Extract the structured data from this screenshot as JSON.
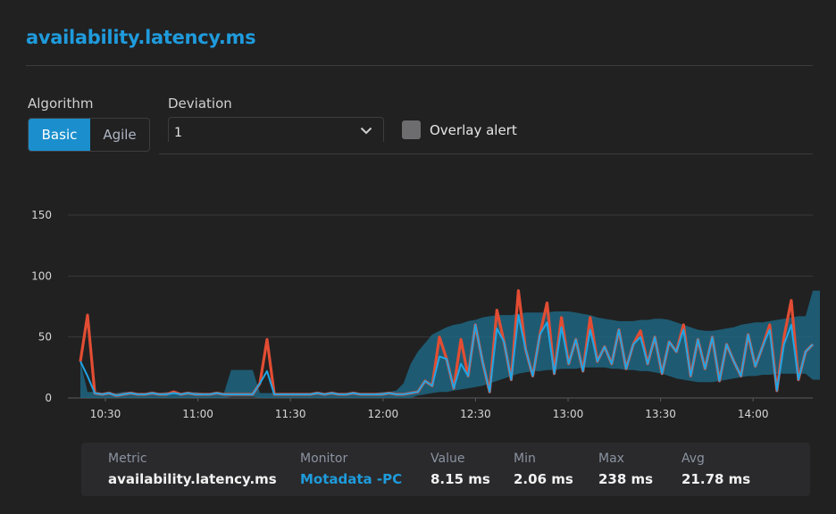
{
  "title": "availability.latency.ms",
  "algorithm": {
    "label": "Algorithm",
    "options": [
      "Basic",
      "Agile"
    ],
    "selected": "Basic"
  },
  "deviation": {
    "label": "Deviation",
    "value": "1"
  },
  "overlay_alert": {
    "label": "Overlay alert",
    "checked": false
  },
  "colors": {
    "accent": "#1f9bdc",
    "band": "#1d6f8e",
    "line": "#1fa6e6",
    "anomaly": "#e24d33",
    "background": "#212122"
  },
  "chart_data": {
    "type": "line",
    "x": [
      "10:30",
      "11:00",
      "11:30",
      "12:00",
      "12:30",
      "13:00",
      "13:30",
      "14:00"
    ],
    "y_ticks": [
      0,
      50,
      100,
      150
    ],
    "ylim": [
      0,
      150
    ],
    "grid": true,
    "series": [
      {
        "role": "baseline band (deviation)",
        "upper": [
          30,
          5,
          5,
          4,
          4,
          4,
          5,
          5,
          4,
          4,
          4,
          4,
          5,
          4,
          4,
          4,
          5,
          4,
          4,
          4,
          4,
          23,
          23,
          23,
          23,
          4,
          4,
          4,
          4,
          4,
          4,
          4,
          4,
          4,
          4,
          4,
          4,
          4,
          4,
          4,
          4,
          4,
          5,
          5,
          6,
          12,
          28,
          38,
          45,
          52,
          55,
          58,
          60,
          61,
          63,
          64,
          66,
          67,
          68,
          68,
          68,
          69,
          70,
          70,
          70,
          70,
          71,
          71,
          71,
          70,
          69,
          68,
          66,
          65,
          64,
          63,
          63,
          63,
          64,
          64,
          65,
          65,
          64,
          62,
          60,
          58,
          56,
          55,
          55,
          56,
          57,
          58,
          60,
          61,
          62,
          62,
          63,
          64,
          65,
          66,
          67,
          67,
          88,
          88
        ],
        "lower": [
          0,
          0,
          0,
          0,
          0,
          0,
          0,
          0,
          0,
          0,
          0,
          0,
          0,
          0,
          0,
          0,
          0,
          0,
          0,
          0,
          0,
          1,
          1,
          1,
          1,
          0,
          0,
          0,
          0,
          0,
          0,
          0,
          0,
          0,
          0,
          0,
          0,
          0,
          0,
          0,
          0,
          0,
          0,
          0,
          0,
          0,
          0,
          2,
          3,
          4,
          5,
          5,
          6,
          7,
          8,
          9,
          10,
          12,
          14,
          16,
          18,
          20,
          21,
          22,
          22,
          23,
          23,
          24,
          24,
          24,
          25,
          25,
          25,
          25,
          24,
          24,
          23,
          23,
          22,
          22,
          21,
          20,
          18,
          16,
          15,
          14,
          13,
          13,
          13,
          14,
          15,
          16,
          17,
          18,
          18,
          19,
          19,
          20,
          20,
          20,
          20,
          20,
          15,
          15
        ]
      },
      {
        "role": "latency (anomaly overlay)",
        "values": [
          30,
          68,
          4,
          3,
          4,
          2,
          3,
          4,
          3,
          3,
          4,
          3,
          3,
          5,
          3,
          4,
          3,
          3,
          3,
          4,
          3,
          3,
          3,
          3,
          3,
          12,
          48,
          3,
          3,
          3,
          3,
          3,
          3,
          4,
          3,
          4,
          3,
          3,
          4,
          3,
          3,
          3,
          3,
          4,
          3,
          3,
          4,
          5,
          14,
          10,
          50,
          32,
          8,
          48,
          18,
          60,
          30,
          5,
          72,
          46,
          15,
          88,
          40,
          18,
          52,
          78,
          20,
          66,
          28,
          48,
          22,
          66,
          30,
          42,
          28,
          56,
          24,
          44,
          55,
          28,
          50,
          20,
          46,
          38,
          60,
          18,
          48,
          24,
          50,
          14,
          44,
          30,
          18,
          52,
          26,
          42,
          60,
          6,
          50,
          80,
          15,
          38,
          44
        ]
      },
      {
        "role": "latency (ms)",
        "values": [
          30,
          18,
          4,
          3,
          4,
          2,
          3,
          4,
          3,
          3,
          4,
          3,
          3,
          4,
          3,
          4,
          3,
          3,
          3,
          4,
          3,
          3,
          3,
          3,
          3,
          12,
          22,
          3,
          3,
          3,
          3,
          3,
          3,
          4,
          3,
          4,
          3,
          3,
          4,
          3,
          3,
          3,
          3,
          4,
          3,
          3,
          4,
          5,
          14,
          10,
          34,
          32,
          8,
          28,
          18,
          60,
          30,
          5,
          57,
          46,
          15,
          68,
          40,
          18,
          52,
          62,
          20,
          58,
          28,
          48,
          22,
          56,
          30,
          42,
          28,
          56,
          24,
          44,
          50,
          28,
          50,
          20,
          46,
          38,
          56,
          18,
          48,
          24,
          50,
          14,
          44,
          30,
          18,
          52,
          26,
          42,
          56,
          6,
          44,
          60,
          15,
          38,
          44
        ]
      }
    ]
  },
  "info": {
    "headers": {
      "metric": "Metric",
      "monitor": "Monitor",
      "value": "Value",
      "min": "Min",
      "max": "Max",
      "avg": "Avg"
    },
    "values": {
      "metric": "availability.latency.ms",
      "monitor": "Motadata -PC",
      "value": "8.15 ms",
      "min": "2.06 ms",
      "max": "238 ms",
      "avg": "21.78 ms"
    }
  }
}
